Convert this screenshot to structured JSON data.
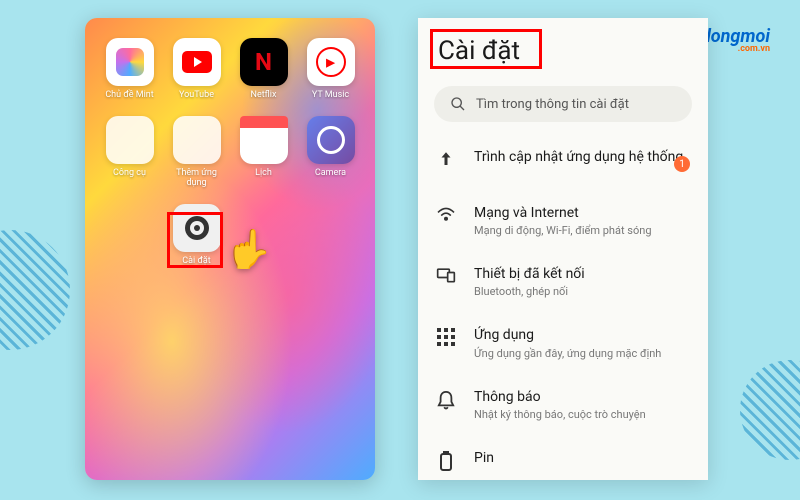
{
  "logo": {
    "text": "Didongmoi",
    "sub": ".com.vn"
  },
  "homescreen": {
    "apps": [
      {
        "label": "Chủ đề Mint"
      },
      {
        "label": "YouTube"
      },
      {
        "label": "Netflix"
      },
      {
        "label": "YT Music"
      },
      {
        "label": "Công cụ"
      },
      {
        "label": "Thêm ứng dụng"
      },
      {
        "label": "Lịch"
      },
      {
        "label": "Camera"
      },
      {
        "label": "Cài đặt"
      }
    ]
  },
  "settings": {
    "title": "Cài đặt",
    "search_placeholder": "Tìm trong thông tin cài đặt",
    "rows": [
      {
        "title": "Trình cập nhật ứng dụng hệ thống",
        "sub": "",
        "badge": "1"
      },
      {
        "title": "Mạng và Internet",
        "sub": "Mạng di động, Wi-Fi, điểm phát sóng"
      },
      {
        "title": "Thiết bị đã kết nối",
        "sub": "Bluetooth, ghép nối"
      },
      {
        "title": "Ứng dụng",
        "sub": "Ứng dụng gần đây, ứng dụng mặc định"
      },
      {
        "title": "Thông báo",
        "sub": "Nhật ký thông báo, cuộc trò chuyện"
      },
      {
        "title": "Pin",
        "sub": ""
      }
    ]
  }
}
